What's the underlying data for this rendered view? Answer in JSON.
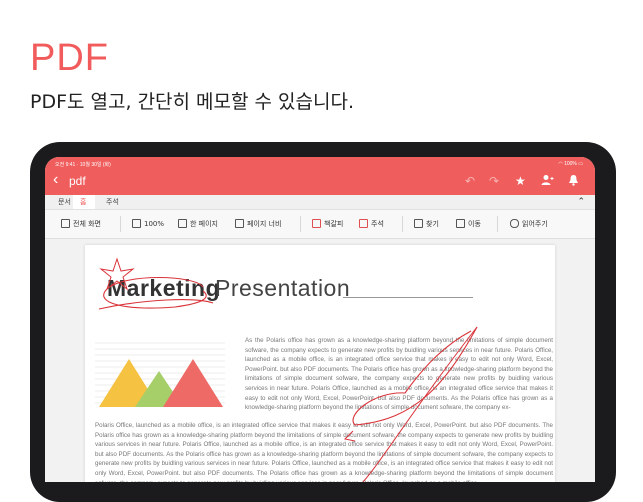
{
  "promo": {
    "headline": "PDF",
    "subline": "PDF도 열고, 간단히 메모할 수 있습니다."
  },
  "status_bar": {
    "time": "오전 9:41 · 10월 30일 (화)",
    "battery": "100%"
  },
  "app_header": {
    "back_icon": "chevron-left-icon",
    "title": "pdf",
    "undo_icon": "undo-icon",
    "redo_icon": "redo-icon",
    "star_icon": "star-icon",
    "share_icon": "person-add-icon",
    "notification_icon": "bell-icon"
  },
  "tabs": [
    {
      "label": "문서",
      "active": false
    },
    {
      "label": "홈",
      "active": true
    },
    {
      "label": "주석",
      "active": false
    }
  ],
  "toolbar": [
    {
      "label": "전체 화면",
      "icon": "fullscreen-icon"
    },
    {
      "label": "100%",
      "icon": "zoom-icon"
    },
    {
      "label": "한 페이지",
      "icon": "single-page-icon"
    },
    {
      "label": "페이지 너비",
      "icon": "page-width-icon"
    },
    {
      "label": "책갈피",
      "icon": "bookmark-icon"
    },
    {
      "label": "주석",
      "icon": "annotation-icon"
    },
    {
      "label": "찾기",
      "icon": "binoculars-icon"
    },
    {
      "label": "이동",
      "icon": "goto-icon"
    },
    {
      "label": "읽어주기",
      "icon": "read-aloud-icon"
    }
  ],
  "document": {
    "title_bold": "Marketing",
    "title_light": "Presentation",
    "paragraph1": "As the Polaris office has grown as a knowledge-sharing platform beyond the limitations of simple document sofware, the company expects to generate new profits by buidling various services in near future. Polaris Office, launched as a mobile office, is an integrated office service that makes it easy to edit not only Word, Excel, PowerPoint. but also PDF documents. The Polaris office has grown as a knowledge-sharing platform beyond the limitations of simple document sofware, the company expects to generate new profits by buidling various services in near future. Polaris Office, launched as a mobile office, is an integrated office service that makes it easy to edit not only Word, Excel, PowerPoint. but also PDF documents. As the Polaris office has grown as a knowledge-sharing platform beyond the limitations of simple document sofware, the company ex-",
    "paragraph2": "Polaris Office, launched as a mobile office, is an integrated office service that makes it easy to edit not only Word, Excel, PowerPoint. but also PDF documents. The Polaris office has grown as a knowledge-sharing platform beyond the limitations of simple document sofware, the company expects to generate new profits by buidling various services in near future. Polaris Office, launched as a mobile office, is an integrated office service that makes it easy to edit not only Word, Excel, PowerPoint. but also PDF documents. As the Polaris office has grown as a knowledge-sharing platform beyond the limitations of simple document sofware, the company expects to generate new profits by buidling various services in near future. Polaris Office, launched as a mobile office, is an integrated office service that makes it easy to edit not only Word, Excel, PowerPoint. but also PDF documents. The Polaris office has grown as a knowledge-sharing platform beyond the limitations of simple document sofware, the company expects to generate new profits by buidling various services in near future. Polaris Office, launched as a mobile office"
  },
  "colors": {
    "accent": "#ef5d5d",
    "mountain_yellow": "#f5c242",
    "mountain_green": "#a6cf6a",
    "mountain_red": "#ee6a67",
    "ink": "#d9343a"
  }
}
